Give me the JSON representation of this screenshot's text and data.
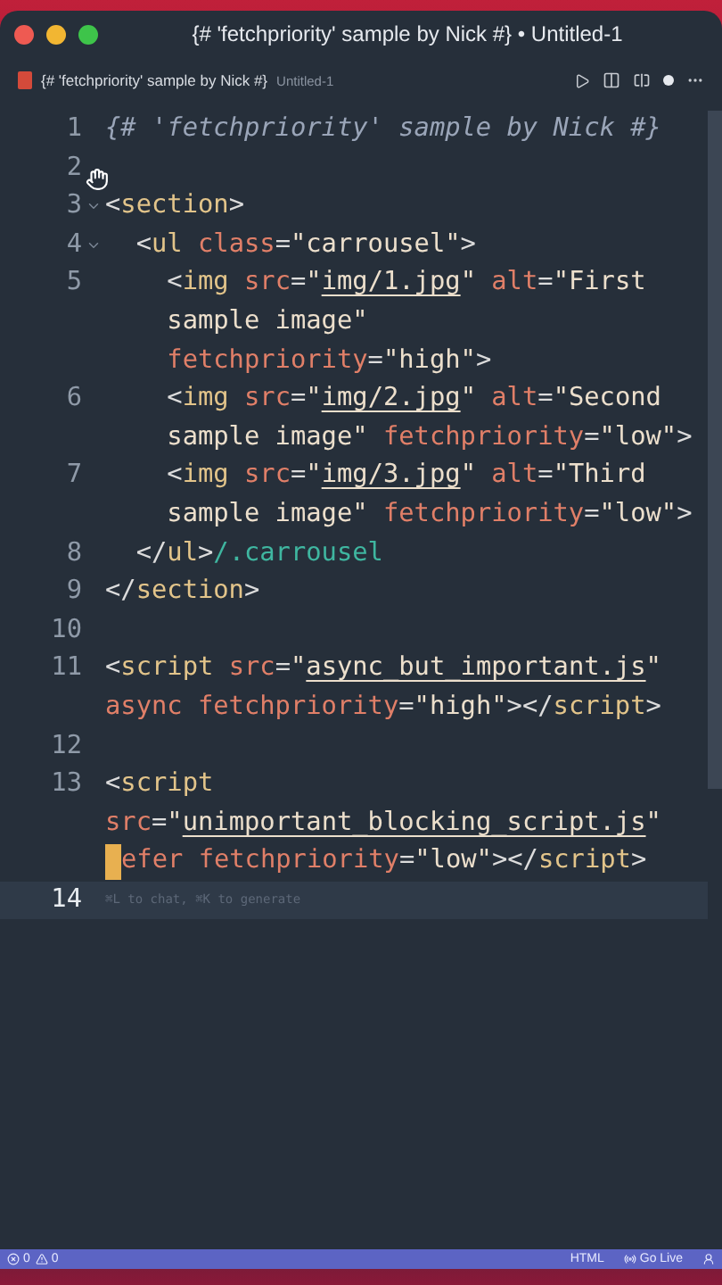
{
  "window": {
    "title": "{# 'fetchpriority' sample by Nick #} • Untitled-1"
  },
  "tab": {
    "title": "{# 'fetchpriority' sample by Nick #}",
    "detail": "Untitled-1",
    "dirty": true
  },
  "code": [
    {
      "number": "1",
      "fold": false,
      "current": false,
      "rows": [
        {
          "segments": [
            {
              "kind": "comment",
              "text": "{# 'fetchpriority' sample by Nick #}"
            }
          ]
        }
      ]
    },
    {
      "number": "2",
      "fold": false,
      "current": false,
      "rows": [
        {
          "segments": []
        }
      ]
    },
    {
      "number": "3",
      "fold": true,
      "current": false,
      "rows": [
        {
          "segments": [
            {
              "kind": "punct",
              "text": "<"
            },
            {
              "kind": "tag",
              "text": "section"
            },
            {
              "kind": "punct",
              "text": ">"
            }
          ]
        }
      ]
    },
    {
      "number": "4",
      "fold": true,
      "current": false,
      "rows": [
        {
          "segments": [
            {
              "kind": "punct",
              "text": "  <"
            },
            {
              "kind": "tag",
              "text": "ul"
            },
            {
              "kind": "attr",
              "text": " class"
            },
            {
              "kind": "punct",
              "text": "="
            },
            {
              "kind": "str",
              "text": "\"carrousel\""
            },
            {
              "kind": "punct",
              "text": ">"
            }
          ]
        }
      ]
    },
    {
      "number": "5",
      "fold": false,
      "current": false,
      "rows": [
        {
          "segments": [
            {
              "kind": "punct",
              "text": "    <"
            },
            {
              "kind": "tag",
              "text": "img"
            },
            {
              "kind": "attr",
              "text": " src"
            },
            {
              "kind": "punct",
              "text": "="
            },
            {
              "kind": "str",
              "text": "\""
            },
            {
              "kind": "link",
              "text": "img/1.jpg"
            },
            {
              "kind": "str",
              "text": "\""
            },
            {
              "kind": "attr",
              "text": " alt"
            },
            {
              "kind": "punct",
              "text": "="
            },
            {
              "kind": "str",
              "text": "\"First"
            }
          ]
        },
        {
          "segments": [
            {
              "kind": "str",
              "text": "    sample image\""
            }
          ]
        },
        {
          "segments": [
            {
              "kind": "attr",
              "text": "    fetchpriority"
            },
            {
              "kind": "punct",
              "text": "="
            },
            {
              "kind": "str",
              "text": "\"high\""
            },
            {
              "kind": "punct",
              "text": ">"
            }
          ]
        }
      ]
    },
    {
      "number": "6",
      "fold": false,
      "current": false,
      "rows": [
        {
          "segments": [
            {
              "kind": "punct",
              "text": "    <"
            },
            {
              "kind": "tag",
              "text": "img"
            },
            {
              "kind": "attr",
              "text": " src"
            },
            {
              "kind": "punct",
              "text": "="
            },
            {
              "kind": "str",
              "text": "\""
            },
            {
              "kind": "link",
              "text": "img/2.jpg"
            },
            {
              "kind": "str",
              "text": "\""
            },
            {
              "kind": "attr",
              "text": " alt"
            },
            {
              "kind": "punct",
              "text": "="
            },
            {
              "kind": "str",
              "text": "\"Second"
            }
          ]
        },
        {
          "segments": [
            {
              "kind": "str",
              "text": "    sample image\""
            },
            {
              "kind": "attr",
              "text": " fetchpriority"
            },
            {
              "kind": "punct",
              "text": "="
            },
            {
              "kind": "str",
              "text": "\"low\""
            },
            {
              "kind": "punct",
              "text": ">"
            }
          ]
        }
      ]
    },
    {
      "number": "7",
      "fold": false,
      "current": false,
      "rows": [
        {
          "segments": [
            {
              "kind": "punct",
              "text": "    <"
            },
            {
              "kind": "tag",
              "text": "img"
            },
            {
              "kind": "attr",
              "text": " src"
            },
            {
              "kind": "punct",
              "text": "="
            },
            {
              "kind": "str",
              "text": "\""
            },
            {
              "kind": "link",
              "text": "img/3.jpg"
            },
            {
              "kind": "str",
              "text": "\""
            },
            {
              "kind": "attr",
              "text": " alt"
            },
            {
              "kind": "punct",
              "text": "="
            },
            {
              "kind": "str",
              "text": "\"Third"
            }
          ]
        },
        {
          "segments": [
            {
              "kind": "str",
              "text": "    sample image\""
            },
            {
              "kind": "attr",
              "text": " fetchpriority"
            },
            {
              "kind": "punct",
              "text": "="
            },
            {
              "kind": "str",
              "text": "\"low\""
            },
            {
              "kind": "punct",
              "text": ">"
            }
          ]
        }
      ]
    },
    {
      "number": "8",
      "fold": false,
      "current": false,
      "rows": [
        {
          "segments": [
            {
              "kind": "punct",
              "text": "  </"
            },
            {
              "kind": "tag",
              "text": "ul"
            },
            {
              "kind": "punct",
              "text": ">"
            },
            {
              "kind": "hint",
              "text": "/.carrousel"
            }
          ]
        }
      ]
    },
    {
      "number": "9",
      "fold": false,
      "current": false,
      "rows": [
        {
          "segments": [
            {
              "kind": "punct",
              "text": "</"
            },
            {
              "kind": "tag",
              "text": "section"
            },
            {
              "kind": "punct",
              "text": ">"
            }
          ]
        }
      ]
    },
    {
      "number": "10",
      "fold": false,
      "current": false,
      "rows": [
        {
          "segments": []
        }
      ]
    },
    {
      "number": "11",
      "fold": false,
      "current": false,
      "rows": [
        {
          "segments": [
            {
              "kind": "punct",
              "text": "<"
            },
            {
              "kind": "tag",
              "text": "script"
            },
            {
              "kind": "attr",
              "text": " src"
            },
            {
              "kind": "punct",
              "text": "="
            },
            {
              "kind": "str",
              "text": "\""
            },
            {
              "kind": "link",
              "text": "async_but_important.js"
            },
            {
              "kind": "str",
              "text": "\""
            }
          ]
        },
        {
          "segments": [
            {
              "kind": "attr",
              "text": "async fetchpriority"
            },
            {
              "kind": "punct",
              "text": "="
            },
            {
              "kind": "str",
              "text": "\"high\""
            },
            {
              "kind": "punct",
              "text": "></"
            },
            {
              "kind": "tag",
              "text": "script"
            },
            {
              "kind": "punct",
              "text": ">"
            }
          ]
        }
      ]
    },
    {
      "number": "12",
      "fold": false,
      "current": false,
      "rows": [
        {
          "segments": []
        }
      ]
    },
    {
      "number": "13",
      "fold": false,
      "current": false,
      "rows": [
        {
          "segments": [
            {
              "kind": "punct",
              "text": "<"
            },
            {
              "kind": "tag",
              "text": "script"
            }
          ]
        },
        {
          "segments": [
            {
              "kind": "attr",
              "text": "src"
            },
            {
              "kind": "punct",
              "text": "="
            },
            {
              "kind": "str",
              "text": "\""
            },
            {
              "kind": "link",
              "text": "unimportant_blocking_script.js"
            },
            {
              "kind": "str",
              "text": "\""
            }
          ]
        },
        {
          "segments": [
            {
              "kind": "cursor"
            },
            {
              "kind": "attr",
              "text": "efer fetchpriority"
            },
            {
              "kind": "punct",
              "text": "="
            },
            {
              "kind": "str",
              "text": "\"low\""
            },
            {
              "kind": "punct",
              "text": "></"
            },
            {
              "kind": "tag",
              "text": "script"
            },
            {
              "kind": "punct",
              "text": ">"
            }
          ]
        }
      ]
    },
    {
      "number": "14",
      "fold": false,
      "current": true,
      "rows": [
        {
          "segments": [
            {
              "kind": "ghost",
              "text": "⌘L to chat, ⌘K to generate"
            }
          ]
        }
      ]
    }
  ],
  "status_bar": {
    "errors": "0",
    "warnings": "0",
    "language": "HTML",
    "live": "Go Live"
  }
}
